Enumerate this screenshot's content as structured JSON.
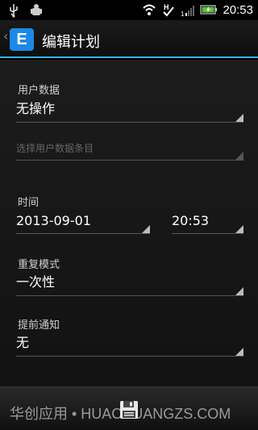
{
  "status_bar": {
    "time": "20:53",
    "icons": [
      "usb-icon",
      "android-debug-icon",
      "wifi-icon",
      "h-signal-icon",
      "signal-bars-icon",
      "battery-charging-icon"
    ]
  },
  "action_bar": {
    "logo_letter": "E",
    "title": "编辑计划"
  },
  "form": {
    "user_data_label": "用户数据",
    "user_data_value": "无操作",
    "user_data_item_placeholder": "选择用户数据条目",
    "time_label": "时间",
    "date_value": "2013-09-01",
    "time_value": "20:53",
    "repeat_label": "重复模式",
    "repeat_value": "一次性",
    "notify_label": "提前通知",
    "notify_value": "无"
  },
  "bottom": {
    "watermark": "华创应用 • HUACHUANGZS.COM",
    "save_icon": "save-icon"
  },
  "colors": {
    "accent": "#33b5e5",
    "logo": "#1e88e5"
  }
}
